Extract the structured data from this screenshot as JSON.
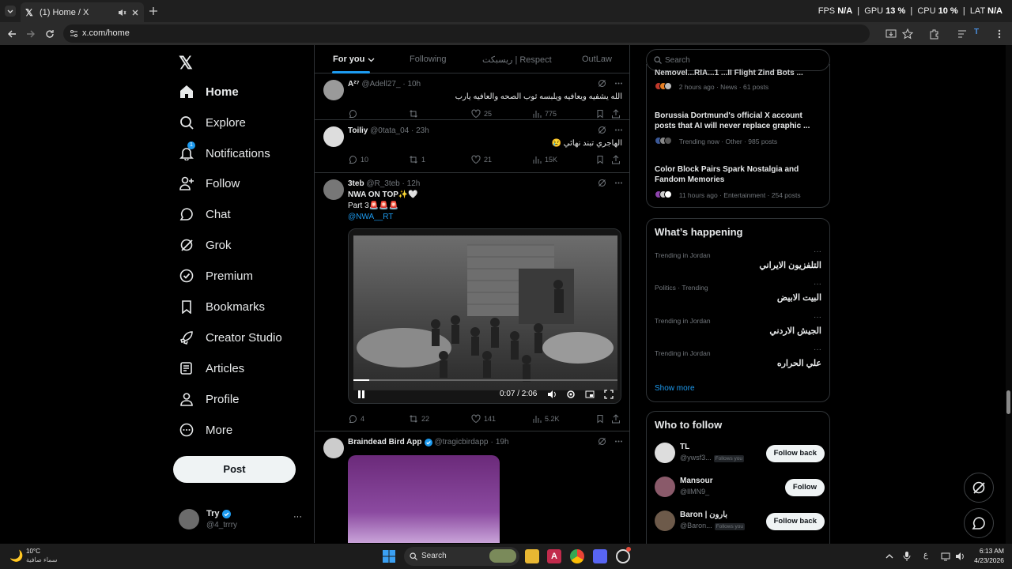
{
  "browser": {
    "tab_title": "(1) Home / X",
    "url": "x.com/home",
    "stats": {
      "fps_label": "FPS",
      "fps": "N/A",
      "gpu_label": "GPU",
      "gpu": "13 %",
      "cpu_label": "CPU",
      "cpu": "10 %",
      "lat_label": "LAT",
      "lat": "N/A"
    }
  },
  "nav": {
    "items": [
      {
        "label": "Home",
        "icon": "home-icon"
      },
      {
        "label": "Explore",
        "icon": "search-icon"
      },
      {
        "label": "Notifications",
        "icon": "bell-icon",
        "badge": "1"
      },
      {
        "label": "Follow",
        "icon": "person-add-icon"
      },
      {
        "label": "Chat",
        "icon": "chat-icon"
      },
      {
        "label": "Grok",
        "icon": "grok-icon"
      },
      {
        "label": "Premium",
        "icon": "premium-icon"
      },
      {
        "label": "Bookmarks",
        "icon": "bookmark-icon"
      },
      {
        "label": "Creator Studio",
        "icon": "rocket-icon"
      },
      {
        "label": "Articles",
        "icon": "articles-icon"
      },
      {
        "label": "Profile",
        "icon": "person-icon"
      },
      {
        "label": "More",
        "icon": "more-circle-icon"
      }
    ],
    "post_label": "Post",
    "account": {
      "name": "Try",
      "handle": "@4_trrry",
      "more": "···"
    }
  },
  "feed": {
    "tabs": [
      "For you",
      "Following",
      "ريسبكت | Respect",
      "OutLaw"
    ],
    "tweets": [
      {
        "name": "A²⁷",
        "handle": "@Adell27_",
        "time": "10h",
        "text": "الله يشفيه ويعافيه ويلبسه ثوب الصحه والعافيه يارب",
        "replies": "",
        "retweets": "",
        "likes": "25",
        "views": "775"
      },
      {
        "name": "Toiliy",
        "handle": "@0tata_04",
        "time": "23h",
        "text": "الهاجري تبند نهائي 😢",
        "replies": "10",
        "retweets": "1",
        "likes": "21",
        "views": "15K"
      },
      {
        "name": "3teb",
        "handle": "@R_3teb",
        "time": "12h",
        "line1": "NWA ON TOP✨🤍",
        "line2": "Part 3🚨🚨🚨",
        "link": "@NWA__RT",
        "video_time": "0:07 / 2:06",
        "video_progress": 0.06,
        "replies": "4",
        "retweets": "22",
        "likes": "141",
        "views": "5.2K"
      },
      {
        "name": "Braindead Bird App",
        "handle": "@tragicbirdapp",
        "time": "19h"
      }
    ]
  },
  "right": {
    "search_placeholder": "Search",
    "news": [
      {
        "title": "Nemovel...RIA...1 ...II Flight Zind Bots ...",
        "meta": "2 hours ago · News · 61 posts"
      },
      {
        "title": "Borussia Dortmund's official X account posts that AI will never replace graphic ...",
        "meta": "Trending now · Other · 985 posts"
      },
      {
        "title": "Color Block Pairs Spark Nostalgia and Fandom Memories",
        "meta": "11 hours ago · Entertainment · 254 posts"
      }
    ],
    "happening_title": "What’s happening",
    "trends": [
      {
        "context": "Trending in Jordan",
        "name": "التلفزيون الايراني"
      },
      {
        "context": "Politics · Trending",
        "name": "البيت الابيض"
      },
      {
        "context": "Trending in Jordan",
        "name": "الجيش الاردني"
      },
      {
        "context": "Trending in Jordan",
        "name": "علي الحراره"
      }
    ],
    "show_more": "Show more",
    "wtf_title": "Who to follow",
    "follows_you": "Follows you",
    "wtf": [
      {
        "name": "TL",
        "handle": "@ywsf3...",
        "follows_you": true,
        "button": "Follow back"
      },
      {
        "name": "Mansour",
        "handle": "@llMN9_",
        "follows_you": false,
        "button": "Follow"
      },
      {
        "name": "Baron | بارون",
        "handle": "@Baron...",
        "follows_you": true,
        "button": "Follow back"
      }
    ]
  },
  "taskbar": {
    "weather_temp": "10°C",
    "weather_text": "سماء صافية",
    "search_label": "Search",
    "lang": "ع",
    "time": "6:13 AM",
    "date": "4/23/2026"
  },
  "colors": {
    "accent": "#1d9bf0",
    "bg": "#000000",
    "border": "#2f3336",
    "muted": "#71767b",
    "text": "#e7e9ea"
  }
}
